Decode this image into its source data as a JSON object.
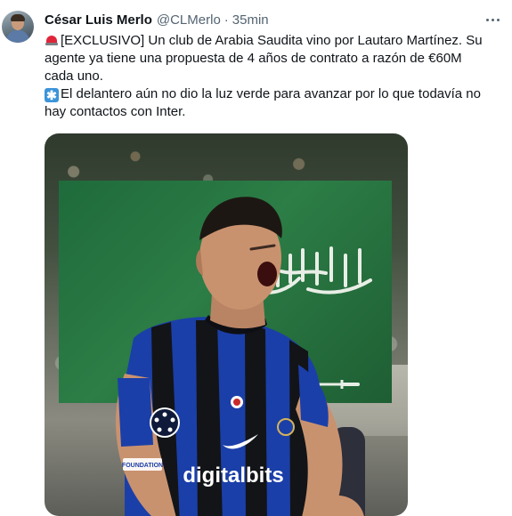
{
  "tweet": {
    "author_name": "César Luis Merlo",
    "author_handle": "@CLMerlo",
    "separator": "·",
    "timestamp": "35min",
    "para1_icon": "police-light-siren-icon",
    "para1_text": "[EXCLUSIVO] Un club de Arabia Saudita vino por Lautaro Martínez. Su agente ya tiene una propuesta de 4 años de contrato a razón de €60M cada uno.",
    "para2_icon": "asterisk-icon",
    "para2_icon_glyph": "✱",
    "para2_text": "El delantero aún no dio la luz verde para avanzar por lo que todavía no hay contactos con Inter."
  },
  "media": {
    "image_subject": "footballer-celebrating-saudi-flag",
    "shirt_sponsor": "digitalbits",
    "foundation_patch": "FOUNDATION"
  },
  "colors": {
    "flag_green": "#1f6b3b",
    "shirt_blue": "#1b3fa8",
    "text_primary": "#0f1419",
    "text_secondary": "#536471"
  }
}
